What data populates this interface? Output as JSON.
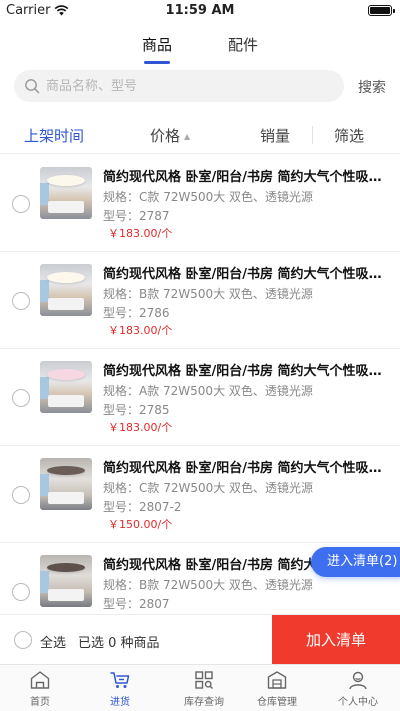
{
  "status_bar": {
    "carrier": "Carrier",
    "time": "11:59 AM"
  },
  "top_tabs": [
    {
      "label": "商品",
      "active": true
    },
    {
      "label": "配件",
      "active": false
    }
  ],
  "search": {
    "placeholder": "商品名称、型号",
    "button": "搜索"
  },
  "sort_bar": {
    "listing_time": "上架时间",
    "price": "价格",
    "sales": "销量",
    "filter": "筛选"
  },
  "products": [
    {
      "title": "简约现代风格 卧室/阳台/书房 简约大气个性吸顶灯",
      "spec": "规格：C款 72W500大 双色、透镜光源",
      "model": "型号：2787",
      "price": "￥183.00/个"
    },
    {
      "title": "简约现代风格 卧室/阳台/书房 简约大气个性吸顶灯",
      "spec": "规格：B款 72W500大 双色、透镜光源",
      "model": "型号：2786",
      "price": "￥183.00/个"
    },
    {
      "title": "简约现代风格 卧室/阳台/书房 简约大气个性吸顶灯",
      "spec": "规格：A款 72W500大 双色、透镜光源",
      "model": "型号：2785",
      "price": "￥183.00/个"
    },
    {
      "title": "简约现代风格 卧室/阳台/书房 简约大气个性吸顶灯",
      "spec": "规格：C款 72W500大 双色、透镜光源",
      "model": "型号：2807-2",
      "price": "￥150.00/个"
    },
    {
      "title": "简约现代风格 卧室/阳台/书房 简约大气个性吸顶灯",
      "spec": "规格：B款 72W500大 双色、透镜光源",
      "model": "型号：2807",
      "price": ""
    }
  ],
  "floating": {
    "label": "进入清单(2)"
  },
  "action_bar": {
    "select_all": "全选",
    "selected_count": "已选 0 种商品",
    "add_button": "加入清单"
  },
  "tab_bar": [
    {
      "label": "首页",
      "icon": "home-icon",
      "active": false
    },
    {
      "label": "进货",
      "icon": "cart-icon",
      "active": true
    },
    {
      "label": "库存查询",
      "icon": "inventory-icon",
      "active": false
    },
    {
      "label": "仓库管理",
      "icon": "warehouse-icon",
      "active": false
    },
    {
      "label": "个人中心",
      "icon": "profile-icon",
      "active": false
    }
  ],
  "colors": {
    "accent": "#2f55d4",
    "price": "#e02a2a",
    "add_button": "#f03a2e",
    "floating": "#3d6ff0"
  }
}
